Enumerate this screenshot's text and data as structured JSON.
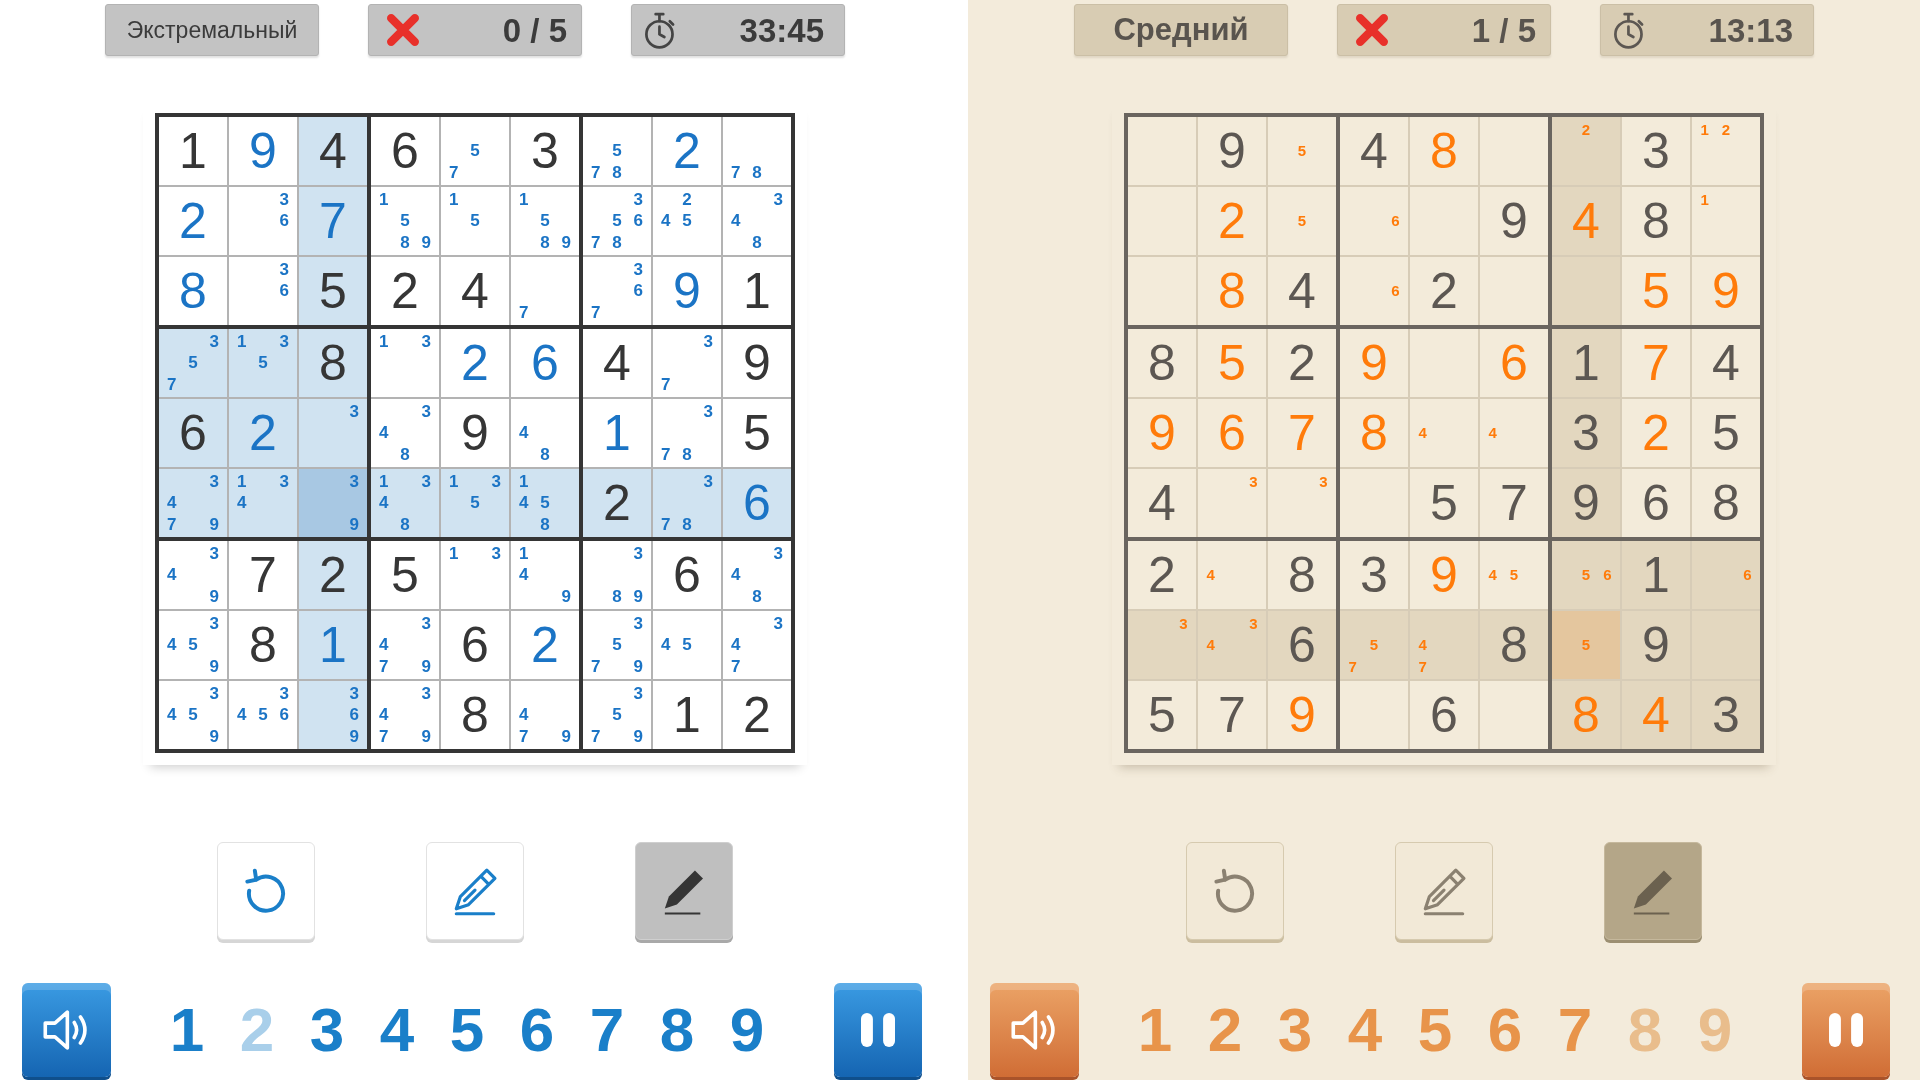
{
  "panels": [
    {
      "kind": "blue",
      "header": {
        "difficulty": "Экстремальный",
        "mistakes": "0 / 5",
        "timer": "33:45"
      },
      "board": {
        "rows": [
          [
            {
              "kind": "given",
              "value": "1",
              "selected": false
            },
            {
              "kind": "entered",
              "value": "9",
              "selected": false
            },
            {
              "kind": "given",
              "value": "4",
              "selected": false
            },
            {
              "kind": "given",
              "value": "6",
              "selected": false
            },
            {
              "kind": "notes",
              "notes": [
                "5",
                "7"
              ],
              "selected": false
            },
            {
              "kind": "given",
              "value": "3",
              "selected": false
            },
            {
              "kind": "notes",
              "notes": [
                "5",
                "7",
                "8"
              ],
              "selected": false
            },
            {
              "kind": "entered",
              "value": "2",
              "selected": false
            },
            {
              "kind": "notes",
              "notes": [
                "7",
                "8"
              ],
              "selected": false
            }
          ],
          [
            {
              "kind": "entered",
              "value": "2",
              "selected": false
            },
            {
              "kind": "notes",
              "notes": [
                "3",
                "6"
              ],
              "selected": false
            },
            {
              "kind": "entered",
              "value": "7",
              "selected": false
            },
            {
              "kind": "notes",
              "notes": [
                "1",
                "5",
                "8",
                "9"
              ],
              "selected": false
            },
            {
              "kind": "notes",
              "notes": [
                "1",
                "5"
              ],
              "selected": false
            },
            {
              "kind": "notes",
              "notes": [
                "1",
                "5",
                "8",
                "9"
              ],
              "selected": false
            },
            {
              "kind": "notes",
              "notes": [
                "3",
                "5",
                "6",
                "7",
                "8"
              ],
              "selected": false
            },
            {
              "kind": "notes",
              "notes": [
                "2",
                "4",
                "5"
              ],
              "selected": false
            },
            {
              "kind": "notes",
              "notes": [
                "3",
                "4",
                "8"
              ],
              "selected": false
            }
          ],
          [
            {
              "kind": "entered",
              "value": "8",
              "selected": false
            },
            {
              "kind": "notes",
              "notes": [
                "3",
                "6"
              ],
              "selected": false
            },
            {
              "kind": "given",
              "value": "5",
              "selected": false
            },
            {
              "kind": "given",
              "value": "2",
              "selected": false
            },
            {
              "kind": "given",
              "value": "4",
              "selected": false
            },
            {
              "kind": "notes",
              "notes": [
                "7"
              ],
              "selected": false
            },
            {
              "kind": "notes",
              "notes": [
                "3",
                "6",
                "7"
              ],
              "selected": false
            },
            {
              "kind": "entered",
              "value": "9",
              "selected": false
            },
            {
              "kind": "given",
              "value": "1",
              "selected": false
            }
          ],
          [
            {
              "kind": "notes",
              "notes": [
                "3",
                "5",
                "7"
              ],
              "selected": false
            },
            {
              "kind": "notes",
              "notes": [
                "1",
                "3",
                "5"
              ],
              "selected": false
            },
            {
              "kind": "given",
              "value": "8",
              "selected": false
            },
            {
              "kind": "notes",
              "notes": [
                "1",
                "3"
              ],
              "selected": false
            },
            {
              "kind": "entered",
              "value": "2",
              "selected": false
            },
            {
              "kind": "entered",
              "value": "6",
              "selected": false
            },
            {
              "kind": "given",
              "value": "4",
              "selected": false
            },
            {
              "kind": "notes",
              "notes": [
                "3",
                "7"
              ],
              "selected": false
            },
            {
              "kind": "given",
              "value": "9",
              "selected": false
            }
          ],
          [
            {
              "kind": "given",
              "value": "6",
              "selected": false
            },
            {
              "kind": "entered",
              "value": "2",
              "selected": false
            },
            {
              "kind": "notes",
              "notes": [
                "3"
              ],
              "selected": false
            },
            {
              "kind": "notes",
              "notes": [
                "3",
                "4",
                "8"
              ],
              "selected": false
            },
            {
              "kind": "given",
              "value": "9",
              "selected": false
            },
            {
              "kind": "notes",
              "notes": [
                "4",
                "8"
              ],
              "selected": false
            },
            {
              "kind": "entered",
              "value": "1",
              "selected": false
            },
            {
              "kind": "notes",
              "notes": [
                "3",
                "7",
                "8"
              ],
              "selected": false
            },
            {
              "kind": "given",
              "value": "5",
              "selected": false
            }
          ],
          [
            {
              "kind": "notes",
              "notes": [
                "3",
                "4",
                "7",
                "9"
              ],
              "selected": false
            },
            {
              "kind": "notes",
              "notes": [
                "1",
                "3",
                "4"
              ],
              "selected": false
            },
            {
              "kind": "notes",
              "notes": [
                "3",
                "9"
              ],
              "selected": true
            },
            {
              "kind": "notes",
              "notes": [
                "1",
                "3",
                "4",
                "8"
              ],
              "selected": false
            },
            {
              "kind": "notes",
              "notes": [
                "1",
                "3",
                "5"
              ],
              "selected": false
            },
            {
              "kind": "notes",
              "notes": [
                "1",
                "4",
                "5",
                "8"
              ],
              "selected": false
            },
            {
              "kind": "given",
              "value": "2",
              "selected": false
            },
            {
              "kind": "notes",
              "notes": [
                "3",
                "7",
                "8"
              ],
              "selected": false
            },
            {
              "kind": "entered",
              "value": "6",
              "selected": false
            }
          ],
          [
            {
              "kind": "notes",
              "notes": [
                "3",
                "4",
                "9"
              ],
              "selected": false
            },
            {
              "kind": "given",
              "value": "7",
              "selected": false
            },
            {
              "kind": "given",
              "value": "2",
              "selected": false
            },
            {
              "kind": "given",
              "value": "5",
              "selected": false
            },
            {
              "kind": "notes",
              "notes": [
                "1",
                "3"
              ],
              "selected": false
            },
            {
              "kind": "notes",
              "notes": [
                "1",
                "4",
                "9"
              ],
              "selected": false
            },
            {
              "kind": "notes",
              "notes": [
                "3",
                "8",
                "9"
              ],
              "selected": false
            },
            {
              "kind": "given",
              "value": "6",
              "selected": false
            },
            {
              "kind": "notes",
              "notes": [
                "3",
                "4",
                "8"
              ],
              "selected": false
            }
          ],
          [
            {
              "kind": "notes",
              "notes": [
                "3",
                "4",
                "5",
                "9"
              ],
              "selected": false
            },
            {
              "kind": "given",
              "value": "8",
              "selected": false
            },
            {
              "kind": "entered",
              "value": "1",
              "selected": false
            },
            {
              "kind": "notes",
              "notes": [
                "3",
                "4",
                "7",
                "9"
              ],
              "selected": false
            },
            {
              "kind": "given",
              "value": "6",
              "selected": false
            },
            {
              "kind": "entered",
              "value": "2",
              "selected": false
            },
            {
              "kind": "notes",
              "notes": [
                "3",
                "5",
                "7",
                "9"
              ],
              "selected": false
            },
            {
              "kind": "notes",
              "notes": [
                "4",
                "5"
              ],
              "selected": false
            },
            {
              "kind": "notes",
              "notes": [
                "3",
                "4",
                "7"
              ],
              "selected": false
            }
          ],
          [
            {
              "kind": "notes",
              "notes": [
                "3",
                "4",
                "5",
                "9"
              ],
              "selected": false
            },
            {
              "kind": "notes",
              "notes": [
                "3",
                "4",
                "5",
                "6"
              ],
              "selected": false
            },
            {
              "kind": "notes",
              "notes": [
                "3",
                "6",
                "9"
              ],
              "selected": false
            },
            {
              "kind": "notes",
              "notes": [
                "3",
                "4",
                "7",
                "9"
              ],
              "selected": false
            },
            {
              "kind": "given",
              "value": "8",
              "selected": false
            },
            {
              "kind": "notes",
              "notes": [
                "4",
                "7",
                "9"
              ],
              "selected": false
            },
            {
              "kind": "notes",
              "notes": [
                "3",
                "5",
                "7",
                "9"
              ],
              "selected": false
            },
            {
              "kind": "given",
              "value": "1",
              "selected": false
            },
            {
              "kind": "given",
              "value": "2",
              "selected": false
            }
          ]
        ]
      },
      "tools": [
        {
          "kind": "undo",
          "selected": false
        },
        {
          "kind": "notes",
          "selected": false
        },
        {
          "kind": "pen",
          "selected": true
        }
      ],
      "sound": {
        "on": true
      },
      "digits": [
        {
          "label": "1",
          "completed": false
        },
        {
          "label": "2",
          "completed": true
        },
        {
          "label": "3",
          "completed": false
        },
        {
          "label": "4",
          "completed": false
        },
        {
          "label": "5",
          "completed": false
        },
        {
          "label": "6",
          "completed": false
        },
        {
          "label": "7",
          "completed": false
        },
        {
          "label": "8",
          "completed": false
        },
        {
          "label": "9",
          "completed": false
        }
      ]
    },
    {
      "kind": "sepia",
      "header": {
        "difficulty": "Средний",
        "mistakes": "1 / 5",
        "timer": "13:13"
      },
      "board": {
        "rows": [
          [
            {
              "kind": "empty",
              "selected": false
            },
            {
              "kind": "given",
              "value": "9",
              "selected": false
            },
            {
              "kind": "notes",
              "notes": [
                "5"
              ],
              "selected": false
            },
            {
              "kind": "given",
              "value": "4",
              "selected": false
            },
            {
              "kind": "entered",
              "value": "8",
              "selected": false
            },
            {
              "kind": "empty",
              "selected": false
            },
            {
              "kind": "notes",
              "notes": [
                "2"
              ],
              "selected": false
            },
            {
              "kind": "given",
              "value": "3",
              "selected": false
            },
            {
              "kind": "notes",
              "notes": [
                "1",
                "2"
              ],
              "selected": false
            }
          ],
          [
            {
              "kind": "empty",
              "selected": false
            },
            {
              "kind": "entered",
              "value": "2",
              "selected": false
            },
            {
              "kind": "notes",
              "notes": [
                "5"
              ],
              "selected": false
            },
            {
              "kind": "notes",
              "notes": [
                "6"
              ],
              "selected": false
            },
            {
              "kind": "empty",
              "selected": false
            },
            {
              "kind": "given",
              "value": "9",
              "selected": false
            },
            {
              "kind": "entered",
              "value": "4",
              "selected": false
            },
            {
              "kind": "given",
              "value": "8",
              "selected": false
            },
            {
              "kind": "notes",
              "notes": [
                "1"
              ],
              "selected": false
            }
          ],
          [
            {
              "kind": "empty",
              "selected": false
            },
            {
              "kind": "entered",
              "value": "8",
              "selected": false
            },
            {
              "kind": "given",
              "value": "4",
              "selected": false
            },
            {
              "kind": "notes",
              "notes": [
                "6"
              ],
              "selected": false
            },
            {
              "kind": "given",
              "value": "2",
              "selected": false
            },
            {
              "kind": "empty",
              "selected": false
            },
            {
              "kind": "empty",
              "selected": false
            },
            {
              "kind": "entered",
              "value": "5",
              "selected": false
            },
            {
              "kind": "entered",
              "value": "9",
              "selected": false
            }
          ],
          [
            {
              "kind": "given",
              "value": "8",
              "selected": false
            },
            {
              "kind": "entered",
              "value": "5",
              "selected": false
            },
            {
              "kind": "given",
              "value": "2",
              "selected": false
            },
            {
              "kind": "entered",
              "value": "9",
              "selected": false
            },
            {
              "kind": "empty",
              "selected": false
            },
            {
              "kind": "entered",
              "value": "6",
              "selected": false
            },
            {
              "kind": "given",
              "value": "1",
              "selected": false
            },
            {
              "kind": "entered",
              "value": "7",
              "selected": false
            },
            {
              "kind": "given",
              "value": "4",
              "selected": false
            }
          ],
          [
            {
              "kind": "entered",
              "value": "9",
              "selected": false
            },
            {
              "kind": "entered",
              "value": "6",
              "selected": false
            },
            {
              "kind": "entered",
              "value": "7",
              "selected": false
            },
            {
              "kind": "entered",
              "value": "8",
              "selected": false
            },
            {
              "kind": "notes",
              "notes": [
                "4"
              ],
              "selected": false
            },
            {
              "kind": "notes",
              "notes": [
                "4"
              ],
              "selected": false
            },
            {
              "kind": "given",
              "value": "3",
              "selected": false
            },
            {
              "kind": "entered",
              "value": "2",
              "selected": false
            },
            {
              "kind": "given",
              "value": "5",
              "selected": false
            }
          ],
          [
            {
              "kind": "given",
              "value": "4",
              "selected": false
            },
            {
              "kind": "notes",
              "notes": [
                "3"
              ],
              "selected": false
            },
            {
              "kind": "notes",
              "notes": [
                "3"
              ],
              "selected": false
            },
            {
              "kind": "empty",
              "selected": false
            },
            {
              "kind": "given",
              "value": "5",
              "selected": false
            },
            {
              "kind": "given",
              "value": "7",
              "selected": false
            },
            {
              "kind": "given",
              "value": "9",
              "selected": false
            },
            {
              "kind": "given",
              "value": "6",
              "selected": false
            },
            {
              "kind": "given",
              "value": "8",
              "selected": false
            }
          ],
          [
            {
              "kind": "given",
              "value": "2",
              "selected": false
            },
            {
              "kind": "notes",
              "notes": [
                "4"
              ],
              "selected": false
            },
            {
              "kind": "given",
              "value": "8",
              "selected": false
            },
            {
              "kind": "given",
              "value": "3",
              "selected": false
            },
            {
              "kind": "entered",
              "value": "9",
              "selected": false
            },
            {
              "kind": "notes",
              "notes": [
                "4",
                "5"
              ],
              "selected": false
            },
            {
              "kind": "notes",
              "notes": [
                "5",
                "6"
              ],
              "selected": false
            },
            {
              "kind": "given",
              "value": "1",
              "selected": false
            },
            {
              "kind": "notes",
              "notes": [
                "6"
              ],
              "selected": false
            }
          ],
          [
            {
              "kind": "notes",
              "notes": [
                "3"
              ],
              "selected": false
            },
            {
              "kind": "notes",
              "notes": [
                "3",
                "4"
              ],
              "selected": false
            },
            {
              "kind": "given",
              "value": "6",
              "selected": false
            },
            {
              "kind": "notes",
              "notes": [
                "5",
                "7"
              ],
              "selected": false
            },
            {
              "kind": "notes",
              "notes": [
                "4",
                "7"
              ],
              "selected": false
            },
            {
              "kind": "given",
              "value": "8",
              "selected": false
            },
            {
              "kind": "notes",
              "notes": [
                "5"
              ],
              "selected": true
            },
            {
              "kind": "given",
              "value": "9",
              "selected": false
            },
            {
              "kind": "empty",
              "selected": false
            }
          ],
          [
            {
              "kind": "given",
              "value": "5",
              "selected": false
            },
            {
              "kind": "given",
              "value": "7",
              "selected": false
            },
            {
              "kind": "entered",
              "value": "9",
              "selected": false
            },
            {
              "kind": "empty",
              "selected": false
            },
            {
              "kind": "given",
              "value": "6",
              "selected": false
            },
            {
              "kind": "empty",
              "selected": false
            },
            {
              "kind": "entered",
              "value": "8",
              "selected": false
            },
            {
              "kind": "entered",
              "value": "4",
              "selected": false
            },
            {
              "kind": "given",
              "value": "3",
              "selected": false
            }
          ]
        ]
      },
      "tools": [
        {
          "kind": "undo",
          "selected": false
        },
        {
          "kind": "notes",
          "selected": false
        },
        {
          "kind": "pen",
          "selected": true
        }
      ],
      "sound": {
        "on": true
      },
      "digits": [
        {
          "label": "1",
          "completed": false
        },
        {
          "label": "2",
          "completed": false
        },
        {
          "label": "3",
          "completed": false
        },
        {
          "label": "4",
          "completed": false
        },
        {
          "label": "5",
          "completed": false
        },
        {
          "label": "6",
          "completed": false
        },
        {
          "label": "7",
          "completed": false
        },
        {
          "label": "8",
          "completed": true
        },
        {
          "label": "9",
          "completed": true
        }
      ]
    }
  ]
}
